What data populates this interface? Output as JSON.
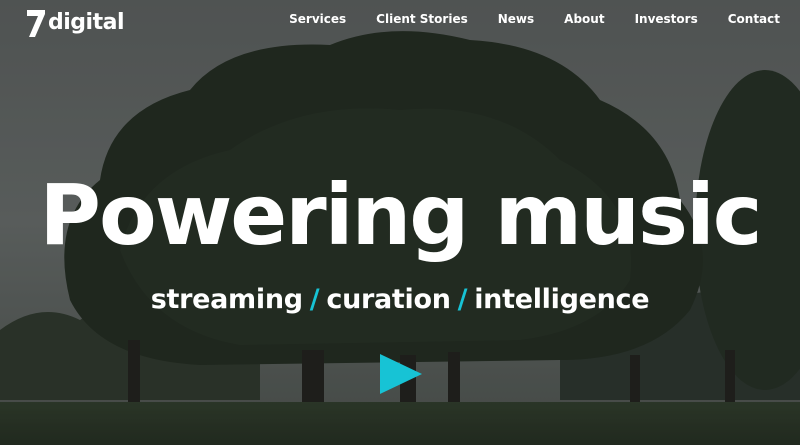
{
  "header": {
    "logo_text": "digital",
    "nav": [
      {
        "label": "Services"
      },
      {
        "label": "Client Stories"
      },
      {
        "label": "News"
      },
      {
        "label": "About"
      },
      {
        "label": "Investors"
      },
      {
        "label": "Contact"
      }
    ]
  },
  "hero": {
    "headline": "Powering music",
    "tagline": {
      "part1": "streaming",
      "separator": "/",
      "part2": "curation",
      "part3": "intelligence"
    },
    "play_icon": "play-icon"
  },
  "colors": {
    "accent": "#17c3d5",
    "text": "#ffffff"
  }
}
